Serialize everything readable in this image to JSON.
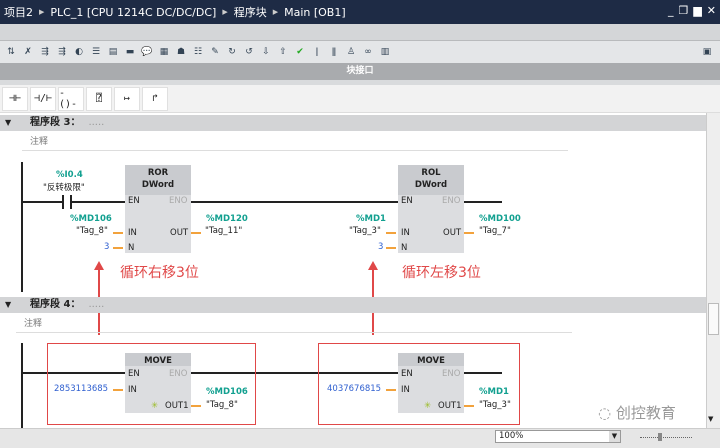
{
  "title": {
    "crumbs": [
      "项目2",
      "PLC_1 [CPU 1214C DC/DC/DC]",
      "程序块",
      "Main [OB1]"
    ]
  },
  "interface_bar": "块接口",
  "networks": [
    {
      "label": "程序段 3：",
      "dots": ".....",
      "comment": "注释",
      "contact": {
        "addr": "%I0.4",
        "tag": "\"反转极限\""
      },
      "blocks": [
        {
          "name": "ROR",
          "type": "DWord",
          "in_addr": "%MD106",
          "in_tag": "\"Tag_8\"",
          "n": "3",
          "out_addr": "%MD120",
          "out_tag": "\"Tag_11\""
        },
        {
          "name": "ROL",
          "type": "DWord",
          "in_addr": "%MD1",
          "in_tag": "\"Tag_3\"",
          "n": "3",
          "out_addr": "%MD100",
          "out_tag": "\"Tag_7\""
        }
      ]
    },
    {
      "label": "程序段 4：",
      "dots": ".....",
      "comment": "注释",
      "blocks": [
        {
          "name": "MOVE",
          "in": "2853113685",
          "out_addr": "%MD106",
          "out_tag": "\"Tag_8\""
        },
        {
          "name": "MOVE",
          "in": "4037676815",
          "out_addr": "%MD1",
          "out_tag": "\"Tag_3\""
        }
      ]
    }
  ],
  "pins": {
    "en": "EN",
    "eno": "ENO",
    "in": "IN",
    "out": "OUT",
    "n": "N",
    "out1": "OUT1"
  },
  "annotations": [
    "循环右移3位",
    "循环左移3位"
  ],
  "watermark": "创控教育",
  "zoom": "100%"
}
